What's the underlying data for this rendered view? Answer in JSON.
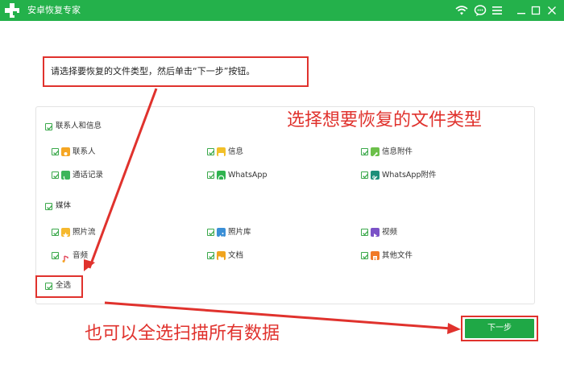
{
  "window": {
    "title": "安卓恢复专家"
  },
  "instruction": "请选择要恢复的文件类型，然后单击“下一步”按钮。",
  "groups": [
    {
      "label": "联系人和信息",
      "items": [
        {
          "label": "联系人",
          "icon": "contacts-icon",
          "color": "#f5a623"
        },
        {
          "label": "信息",
          "icon": "messages-icon",
          "color": "#f2c029"
        },
        {
          "label": "信息附件",
          "icon": "message-attachment-icon",
          "color": "#6cc04a"
        },
        {
          "label": "通话记录",
          "icon": "call-log-icon",
          "color": "#3cb55a"
        },
        {
          "label": "WhatsApp",
          "icon": "whatsapp-icon",
          "color": "#2fb34f"
        },
        {
          "label": "WhatsApp附件",
          "icon": "whatsapp-attachment-icon",
          "color": "#1d8f7a"
        }
      ]
    },
    {
      "label": "媒体",
      "items": [
        {
          "label": "照片流",
          "icon": "photo-stream-icon",
          "color": "#f5b82e"
        },
        {
          "label": "照片库",
          "icon": "photo-library-icon",
          "color": "#3b8fd6"
        },
        {
          "label": "视频",
          "icon": "video-icon",
          "color": "#7b52c7"
        },
        {
          "label": "音频",
          "icon": "audio-icon",
          "color": "#e2465a"
        },
        {
          "label": "文档",
          "icon": "document-icon",
          "color": "#f0a41f"
        },
        {
          "label": "其他文件",
          "icon": "other-files-icon",
          "color": "#f07a28"
        }
      ]
    }
  ],
  "select_all_label": "全选",
  "next_button_label": "下一步",
  "annotations": {
    "top": "选择想要恢复的文件类型",
    "bottom": "也可以全选扫描所有数据"
  },
  "colors": {
    "brand": "#24b14b",
    "annotation": "#e0322d",
    "button": "#1fa846"
  }
}
